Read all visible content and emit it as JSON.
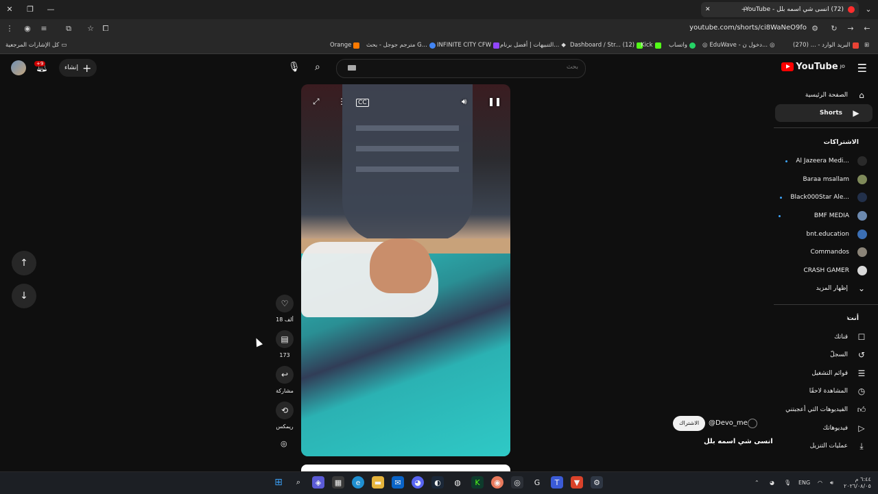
{
  "browser": {
    "tab_title": "(72) انسى شي اسمه بلل - YouTube",
    "url": "youtube.com/shorts/ci8WaNeO9fo",
    "bookmarks": [
      {
        "label": "كل الإشارات المرجعية",
        "icon": "folder-icon",
        "color": "#cfcfcf"
      },
      {
        "label": "Orange",
        "icon": "orange-icon",
        "color": "#ff7a00"
      },
      {
        "label": "مترجم جوجل - بحث G...",
        "icon": "google-icon",
        "color": "#4285f4"
      },
      {
        "label": "INFINITE CITY CFW",
        "icon": "twitch-icon",
        "color": "#9146ff"
      },
      {
        "label": "التنبيهات | أفضل برنام...",
        "icon": "bell-icon",
        "color": "#ffffff"
      },
      {
        "label": "Dashboard / Str... (12)",
        "icon": "kick-icon",
        "color": "#53fc18"
      },
      {
        "label": "Kick",
        "icon": "kick-icon",
        "color": "#53fc18"
      },
      {
        "label": "واتساب",
        "icon": "whatsapp-icon",
        "color": "#25d366"
      },
      {
        "label": "EduWave - دخول ن...",
        "icon": "globe-icon",
        "color": "#cfcfcf"
      },
      {
        "label": "البريد الوارد - ... (270)",
        "icon": "gmail-icon",
        "color": "#ea4335"
      }
    ]
  },
  "header": {
    "logo_text": "YouTube",
    "logo_region": "JO",
    "search_placeholder": "بحث",
    "create_label": "إنشاء",
    "notifications_badge": "+9"
  },
  "sidebar": {
    "items": [
      {
        "label": "الصفحة الرئيسية",
        "icon": "home-icon"
      },
      {
        "label": "Shorts",
        "icon": "shorts-icon"
      }
    ],
    "subscriptions_title": "الاشتراكات",
    "subscriptions": [
      {
        "label": "Al Jazeera Medi...",
        "live": true,
        "color": "#2a2a2a"
      },
      {
        "label": "Baraa msallam",
        "live": false,
        "color": "#7f8a5a"
      },
      {
        "label": "Black000Star Ale...",
        "live": true,
        "color": "#22304a"
      },
      {
        "label": "BMF MEDIA",
        "live": true,
        "color": "#6c8ab0"
      },
      {
        "label": "bnt.education",
        "live": false,
        "color": "#3b6fb5"
      },
      {
        "label": "Commandos",
        "live": false,
        "color": "#8b8478"
      },
      {
        "label": "CRASH GAMER",
        "live": false,
        "color": "#d9d9d9"
      }
    ],
    "show_more_label": "إظهار المزيد",
    "you_title": "أنت",
    "you_items": [
      {
        "label": "قناتك",
        "icon": "channel-icon"
      },
      {
        "label": "السجلّ",
        "icon": "history-icon"
      },
      {
        "label": "قوائم التشغيل",
        "icon": "playlist-icon"
      },
      {
        "label": "المشاهدة لاحقًا",
        "icon": "clock-icon"
      },
      {
        "label": "الفيديوهات التي أعجبتني",
        "icon": "thumbs-up-icon"
      },
      {
        "label": "فيديوهاتك",
        "icon": "video-icon"
      },
      {
        "label": "عمليات التنزيل",
        "icon": "download-icon"
      }
    ]
  },
  "short": {
    "likes": "18 ألف",
    "comments": "173",
    "share_label": "مشاركة",
    "remix_label": "ريمكس",
    "channel": "@Devo_me",
    "subscribe_label": "الاشتراك",
    "title": "انسى شي اسمه بلل"
  },
  "taskbar": {
    "language": "ENG",
    "time": "٦:٤٤ م",
    "date": "٢٠٢٦/٠٨/٠٥"
  }
}
